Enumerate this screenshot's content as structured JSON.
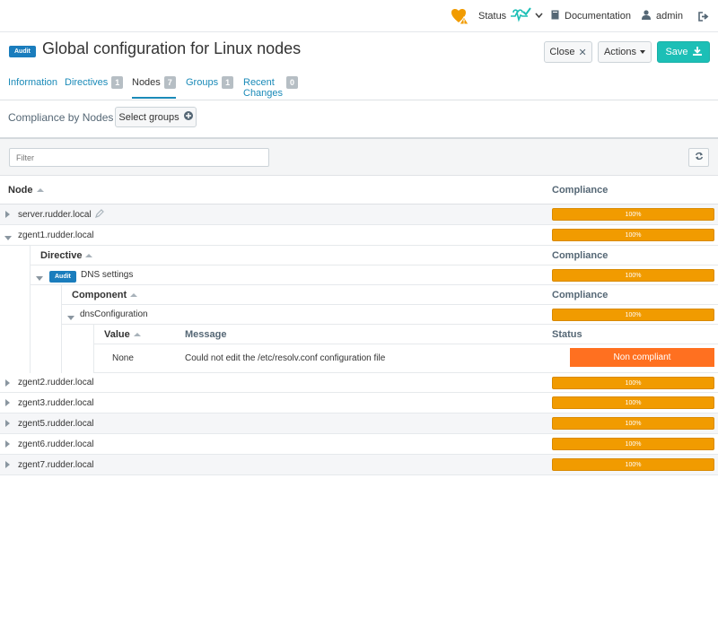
{
  "topbar": {
    "status_label": "Status",
    "documentation_label": "Documentation",
    "user_label": "admin"
  },
  "header": {
    "badge": "Audit",
    "title": "Global configuration for Linux nodes",
    "close_label": "Close",
    "actions_label": "Actions",
    "save_label": "Save"
  },
  "tabs": [
    {
      "label": "Information",
      "count": null
    },
    {
      "label": "Directives",
      "count": "1"
    },
    {
      "label": "Nodes",
      "count": "7"
    },
    {
      "label": "Groups",
      "count": "1"
    },
    {
      "label": "Recent Changes",
      "count": "0"
    }
  ],
  "compliance_section": {
    "title": "Compliance by Nodes",
    "select_groups_label": "Select groups"
  },
  "filter": {
    "placeholder": "Filter"
  },
  "table": {
    "col_node": "Node",
    "col_compliance": "Compliance",
    "col_directive": "Directive",
    "col_component": "Component",
    "col_value": "Value",
    "col_message": "Message",
    "col_status": "Status"
  },
  "nodes": [
    {
      "name": "server.rudder.local",
      "compliance": "100%"
    },
    {
      "name": "zgent1.rudder.local",
      "compliance": "100%"
    },
    {
      "name": "zgent2.rudder.local",
      "compliance": "100%"
    },
    {
      "name": "zgent3.rudder.local",
      "compliance": "100%"
    },
    {
      "name": "zgent5.rudder.local",
      "compliance": "100%"
    },
    {
      "name": "zgent6.rudder.local",
      "compliance": "100%"
    },
    {
      "name": "zgent7.rudder.local",
      "compliance": "100%"
    }
  ],
  "directive": {
    "badge": "Audit",
    "name": "DNS settings",
    "compliance": "100%"
  },
  "component": {
    "name": "dnsConfiguration",
    "compliance": "100%"
  },
  "value_row": {
    "value": "None",
    "message": "Could not edit the /etc/resolv.conf configuration file",
    "status": "Non compliant"
  },
  "colors": {
    "accent": "#1a8ab8",
    "save": "#1cbfb6",
    "compliance_bar": "#f19b00",
    "non_compliant": "#ff7020",
    "audit_badge": "#1a7dbd"
  }
}
